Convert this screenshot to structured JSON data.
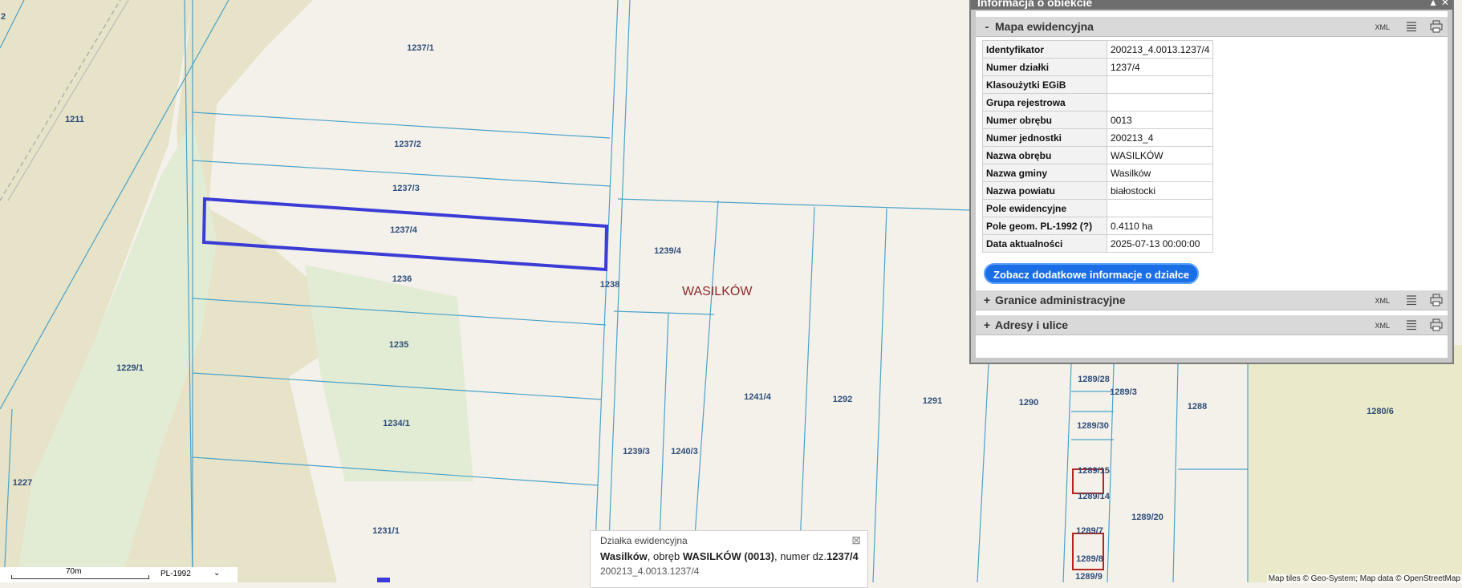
{
  "map": {
    "obreb_label": "WASILKÓW",
    "parcels": [
      "1211",
      "1237/1",
      "1237/2",
      "1237/3",
      "1237/4",
      "1236",
      "1235",
      "1234/1",
      "1231/1",
      "1229/1",
      "1227",
      "1238",
      "1239/4",
      "1239/3",
      "1240/3",
      "1241/4",
      "1292",
      "1291",
      "1290",
      "1289/28",
      "1289/3",
      "1289/30",
      "1289/15",
      "1289/14",
      "1289/7",
      "1289/8",
      "1289/9",
      "1289/20",
      "1288",
      "1280/6",
      "2"
    ]
  },
  "panel": {
    "header": "Informacja o obiekcie",
    "close_glyph": "▲",
    "close2_glyph": "✕",
    "sections": [
      {
        "toggle": "-",
        "title": "Mapa ewidencyjna",
        "xml": "XML"
      },
      {
        "toggle": "+",
        "title": "Granice administracyjne",
        "xml": "XML"
      },
      {
        "toggle": "+",
        "title": "Adresy i ulice",
        "xml": "XML"
      }
    ],
    "rows": [
      {
        "key": "Identyfikator",
        "value": "200213_4.0013.1237/4"
      },
      {
        "key": "Numer działki",
        "value": "1237/4"
      },
      {
        "key": "Klasoużytki EGiB",
        "value": ""
      },
      {
        "key": "Grupa rejestrowa",
        "value": ""
      },
      {
        "key": "Numer obrębu",
        "value": "0013"
      },
      {
        "key": "Numer jednostki",
        "value": "200213_4"
      },
      {
        "key": "Nazwa obrębu",
        "value": "WASILKÓW"
      },
      {
        "key": "Nazwa gminy",
        "value": "Wasilków"
      },
      {
        "key": "Nazwa powiatu",
        "value": "białostocki"
      },
      {
        "key": "Pole ewidencyjne",
        "value": ""
      },
      {
        "key": "Pole geom. PL-1992",
        "help": "?",
        "value": "0.4110 ha"
      },
      {
        "key": "Data aktualności",
        "value": "2025-07-13 00:00:00"
      }
    ],
    "more_button": "Zobacz dodatkowe informacje o działce"
  },
  "popup": {
    "type": "Działka ewidencyjna",
    "place": "Wasilków",
    "sep1": ", obręb ",
    "obreb": "WASILKÓW (0013)",
    "sep2": ", numer dz.",
    "number": "1237/4",
    "id": "200213_4.0013.1237/4",
    "close_glyph": "⊠"
  },
  "scale": {
    "label": "70m",
    "crs": "PL-1992",
    "dropdown": "⌄"
  },
  "attribution": "Map tiles © Geo-System; Map data © OpenStreetMap",
  "colors": {
    "selected_outline": "#3b3bd6",
    "parcel_line": "#4aa3c9",
    "forest": "#e3edd7",
    "meadow": "#e7e4cc"
  }
}
